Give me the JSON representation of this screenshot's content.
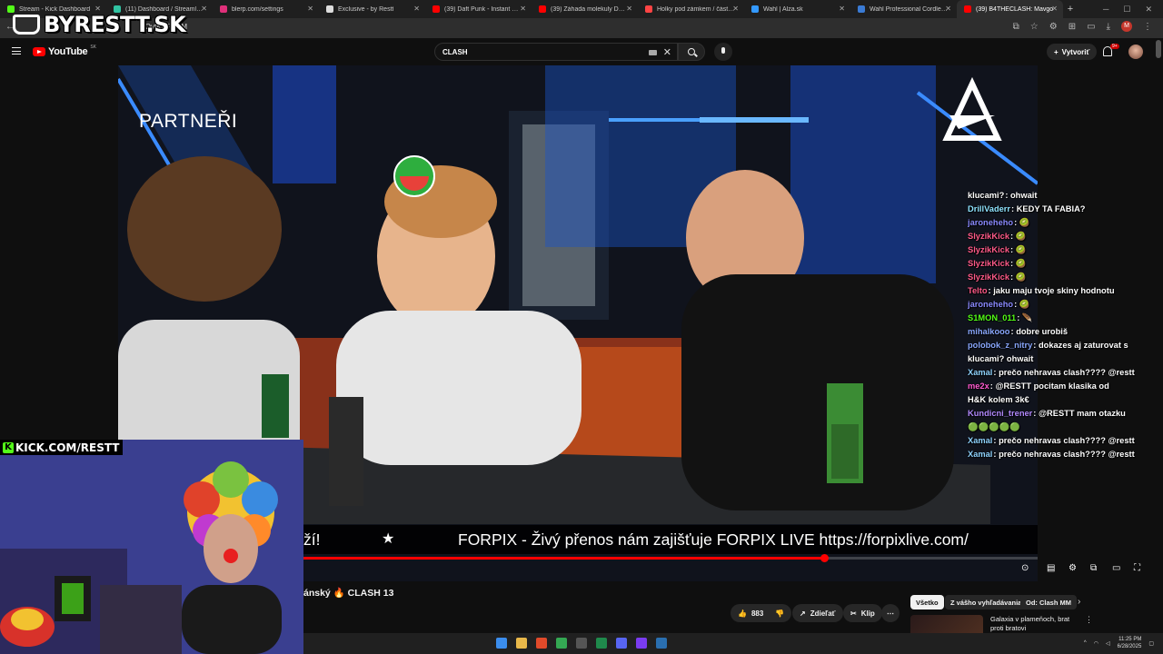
{
  "browser": {
    "tabs": [
      {
        "title": "Stream - Kick Dashboard",
        "color": "#53fc18"
      },
      {
        "title": "(11) Dashboard / Streamlabs",
        "color": "#31c3a2"
      },
      {
        "title": "blerp.com/settings",
        "color": "#e0307a"
      },
      {
        "title": "Exclusive - by Restt",
        "color": "#dddddd"
      },
      {
        "title": "(39) Daft Punk - Instant Crush",
        "color": "#ff0000"
      },
      {
        "title": "(39) Záhada molekuly DMT a je",
        "color": "#ff0000"
      },
      {
        "title": "Holky pod zámkem / část 1 - na",
        "color": "#ff4444"
      },
      {
        "title": "Wahl | Alza.sk",
        "color": "#3399ff"
      },
      {
        "title": "Wahl Professional Cordless De",
        "color": "#3a7bd5"
      },
      {
        "title": "(39) B4THECLASH: Mavgo",
        "color": "#ff0000",
        "active": true
      }
    ],
    "new_tab": "+",
    "url": "CQytKuFHmM"
  },
  "overlay_logo": "BYRESTT.SK",
  "youtube": {
    "logo_text": "YouTube",
    "region": "SK",
    "search_value": "CLASH",
    "create_label": "Vytvoriť",
    "notif_count": "9+"
  },
  "video": {
    "corner_text": "PARTNEŘI",
    "ticker_left": "ží!",
    "ticker_star": "★",
    "ticker_main": "FORPIX - Živý přenos nám zajišťuje FORPIX LIVE https://forpixlive.com/",
    "progress": 0.709
  },
  "chat": [
    {
      "user": "klucami?",
      "color": "#ffffff",
      "msg": "ohwait"
    },
    {
      "user": "DrillVaderr",
      "color": "#8fe3ff",
      "msg": "KEDY TA FABIA?"
    },
    {
      "user": "jaroneheho",
      "color": "#8a8aff",
      "msg": "🥝"
    },
    {
      "user": "SlyzikKick",
      "color": "#ff5b8a",
      "msg": "🥝"
    },
    {
      "user": "SlyzikKick",
      "color": "#ff5b8a",
      "msg": "🥝"
    },
    {
      "user": "SlyzikKick",
      "color": "#ff5b8a",
      "msg": "🥝"
    },
    {
      "user": "SlyzikKick",
      "color": "#ff5b8a",
      "msg": "🥝"
    },
    {
      "user": "Telto",
      "color": "#ff5b8a",
      "msg": "jaku maju tvoje skiny hodnotu"
    },
    {
      "user": "jaroneheho",
      "color": "#8a8aff",
      "msg": "🥝"
    },
    {
      "user": "S1MON_011",
      "color": "#53fc18",
      "msg": "🪶"
    },
    {
      "user": "mihalkooo",
      "color": "#8aa8ff",
      "msg": "dobre urobiš"
    },
    {
      "user": "polobok_z_nitry",
      "color": "#8aa8ff",
      "msg": "dokazes aj zaturovat s"
    },
    {
      "user": "",
      "color": "#ffffff",
      "msg": "klucami? ohwait"
    },
    {
      "user": "Xamal",
      "color": "#8fd3ff",
      "msg": "prečo nehravas clash???? @restt"
    },
    {
      "user": "me2x",
      "color": "#ff5bd0",
      "msg": "@RESTT pocitam klasika od"
    },
    {
      "user": "",
      "color": "#ffffff",
      "msg": "H&K kolem 3k€"
    },
    {
      "user": "Kundicni_trener",
      "color": "#b28aff",
      "msg": "@RESTT mam otazku"
    },
    {
      "user": "",
      "color": "#ffffff",
      "msg": "🟢🟢🟢🟢🟢"
    },
    {
      "user": "Xamal",
      "color": "#8fd3ff",
      "msg": "prečo nehravas clash???? @restt"
    },
    {
      "user": "Xamal",
      "color": "#8fd3ff",
      "msg": "prečo nehravas clash???? @restt"
    }
  ],
  "webcam": {
    "kick_label": "KICK.COM/RESTT"
  },
  "below": {
    "title": "ánský 🔥 CLASH 13",
    "likes": "883",
    "share_label": "Zdieľať",
    "clip_label": "Klip",
    "chips": [
      "Všetko",
      "Z vášho vyhľadávania",
      "Od: Clash MM"
    ],
    "rec_title": "Galaxia v plameňoch, brat proti bratovi"
  },
  "taskbar": {
    "time": "11:25 PM",
    "date": "6/28/2025",
    "icon_colors": [
      "#3b8ded",
      "#e9b84a",
      "#e04a2a",
      "#34a853",
      "#555555",
      "#1f8a4c",
      "#5865f2",
      "#7a3cf0",
      "#2a6fb0"
    ]
  }
}
